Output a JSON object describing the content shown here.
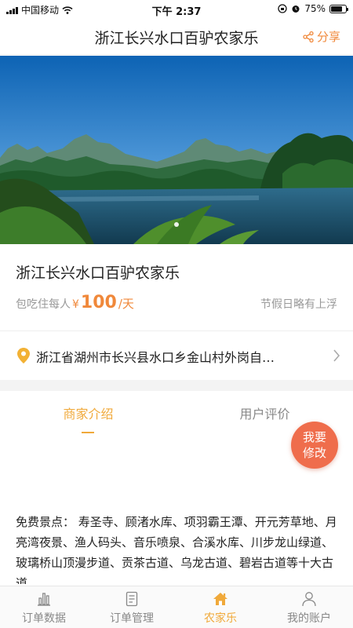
{
  "status_bar": {
    "carrier": "中国移动",
    "time": "下午 2:37",
    "battery": "75%",
    "battery_level": 0.75
  },
  "nav": {
    "title": "浙江长兴水口百驴农家乐",
    "share_label": "分享",
    "share_icon": "share-icon"
  },
  "hero": {
    "slide_count": 1,
    "active_slide": 1
  },
  "listing": {
    "name": "浙江长兴水口百驴农家乐",
    "price_prefix": "包吃住每人",
    "currency": "¥",
    "price": "100",
    "price_unit": "/天",
    "holiday_note": "节假日略有上浮",
    "address": "浙江省湖州市长兴县水口乡金山村外岗自…"
  },
  "tabs": [
    {
      "label": "商家介绍",
      "active": true
    },
    {
      "label": "用户评价",
      "active": false
    }
  ],
  "edit_button": {
    "line1": "我要",
    "line2": "修改"
  },
  "description": "免费景点：  寿圣寺、顾渚水库、项羽霸王潭、开元芳草地、月亮湾夜景、渔人码头、音乐喷泉、合溪水库、川步龙山绿道、玻璃桥山顶漫步道、贡茶古道、乌龙古道、碧岩古道等十大古道",
  "tab_bar": [
    {
      "label": "订单数据",
      "icon": "bar-chart-icon",
      "active": false
    },
    {
      "label": "订单管理",
      "icon": "document-icon",
      "active": false
    },
    {
      "label": "农家乐",
      "icon": "house-icon",
      "active": true
    },
    {
      "label": "我的账户",
      "icon": "person-icon",
      "active": false
    }
  ],
  "colors": {
    "accent": "#f0883a",
    "tab_active": "#f0a93a",
    "fab": "#ef6d4c"
  }
}
